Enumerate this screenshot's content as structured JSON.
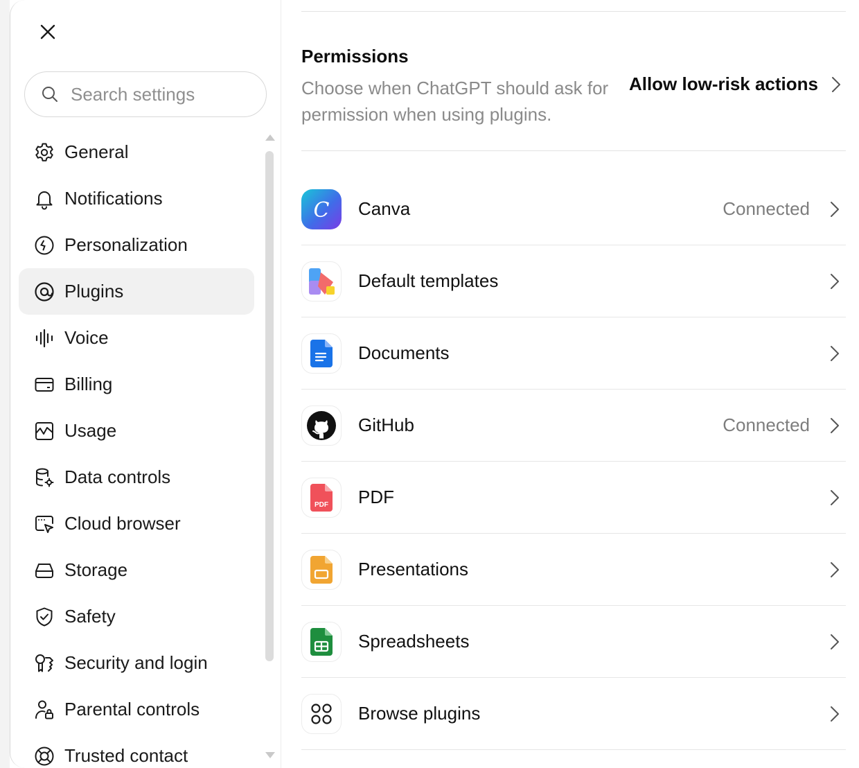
{
  "sidebar": {
    "search_placeholder": "Search settings",
    "items": [
      {
        "label": "General",
        "icon": "gear-icon"
      },
      {
        "label": "Notifications",
        "icon": "bell-icon"
      },
      {
        "label": "Personalization",
        "icon": "personalization-icon"
      },
      {
        "label": "Plugins",
        "icon": "plugins-icon",
        "active": true
      },
      {
        "label": "Voice",
        "icon": "voice-waveform-icon"
      },
      {
        "label": "Billing",
        "icon": "credit-card-icon"
      },
      {
        "label": "Usage",
        "icon": "usage-chart-icon"
      },
      {
        "label": "Data controls",
        "icon": "database-gear-icon"
      },
      {
        "label": "Cloud browser",
        "icon": "cloud-browser-icon"
      },
      {
        "label": "Storage",
        "icon": "storage-drive-icon"
      },
      {
        "label": "Safety",
        "icon": "shield-check-icon"
      },
      {
        "label": "Security and login",
        "icon": "security-key-icon"
      },
      {
        "label": "Parental controls",
        "icon": "parental-lock-icon"
      },
      {
        "label": "Trusted contact",
        "icon": "lifebuoy-icon"
      }
    ]
  },
  "permissions": {
    "title": "Permissions",
    "description": "Choose when ChatGPT should ask for permission when using plugins.",
    "value": "Allow low-risk actions"
  },
  "plugins": [
    {
      "name": "Canva",
      "status": "Connected",
      "icon": "canva-icon"
    },
    {
      "name": "Default templates",
      "status": "",
      "icon": "templates-icon"
    },
    {
      "name": "Documents",
      "status": "",
      "icon": "document-icon"
    },
    {
      "name": "GitHub",
      "status": "Connected",
      "icon": "github-icon"
    },
    {
      "name": "PDF",
      "status": "",
      "icon": "pdf-icon",
      "icon_text": "PDF"
    },
    {
      "name": "Presentations",
      "status": "",
      "icon": "presentation-icon"
    },
    {
      "name": "Spreadsheets",
      "status": "",
      "icon": "spreadsheet-icon"
    },
    {
      "name": "Browse plugins",
      "status": "",
      "icon": "browse-plugins-icon"
    }
  ],
  "colors": {
    "active_bg": "#f1f1f1",
    "muted_text": "#8a8a8a",
    "canva_gradient": [
      "#19c6d8",
      "#3f6de8",
      "#7a3ce6"
    ],
    "documents_blue": "#1a73e8",
    "pdf_red": "#f0515a",
    "presentations_orange": "#f1a532",
    "spreadsheets_green": "#1e8e3e"
  }
}
